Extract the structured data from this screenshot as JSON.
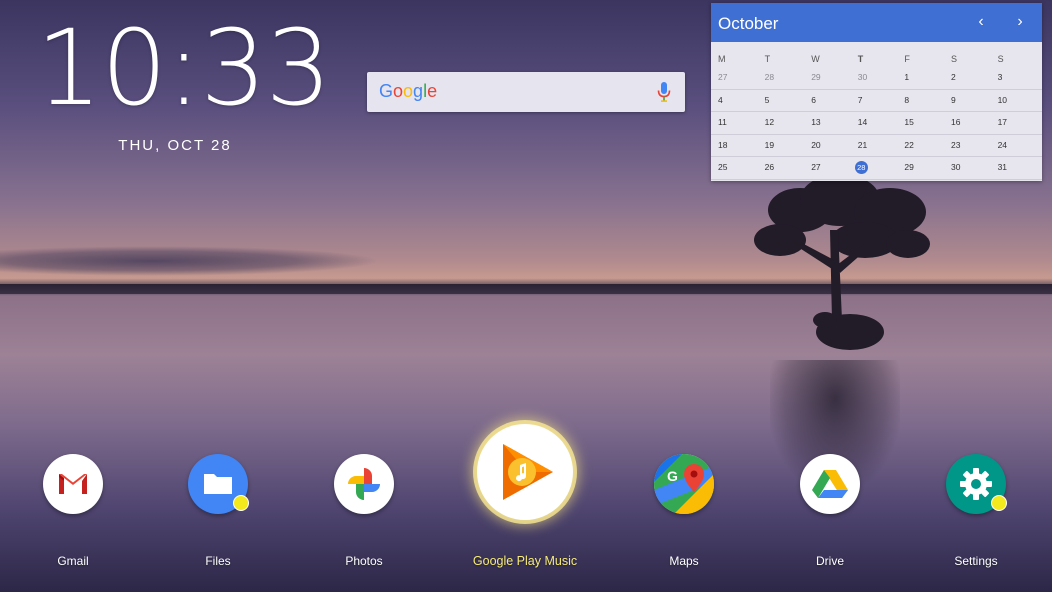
{
  "clock": {
    "time": "10:33",
    "date": "THU, OCT 28"
  },
  "search": {
    "logo_text": "Google",
    "icon": "mic-icon"
  },
  "calendar": {
    "month": "October",
    "weekdays": [
      "M",
      "T",
      "W",
      "T",
      "F",
      "S",
      "S"
    ],
    "today_weekday_index": 3,
    "weeks": [
      [
        "27",
        "28",
        "29",
        "30",
        "1",
        "2",
        "3"
      ],
      [
        "4",
        "5",
        "6",
        "7",
        "8",
        "9",
        "10"
      ],
      [
        "11",
        "12",
        "13",
        "14",
        "15",
        "16",
        "17"
      ],
      [
        "18",
        "19",
        "20",
        "21",
        "22",
        "23",
        "24"
      ],
      [
        "25",
        "26",
        "27",
        "28",
        "29",
        "30",
        "31"
      ]
    ],
    "today": "28",
    "accent": "#3f6fd3"
  },
  "apps": [
    {
      "label": "Gmail",
      "icon": "gmail-icon"
    },
    {
      "label": "Files",
      "icon": "files-icon",
      "badge": true
    },
    {
      "label": "Photos",
      "icon": "photos-icon"
    },
    {
      "label": "Google Play Music",
      "icon": "play-music-icon",
      "focused": true
    },
    {
      "label": "Maps",
      "icon": "maps-icon"
    },
    {
      "label": "Drive",
      "icon": "drive-icon"
    },
    {
      "label": "Settings",
      "icon": "settings-icon",
      "badge": true
    }
  ],
  "colors": {
    "badge": "#f3ea1e",
    "focus_label": "#f6eb7a"
  }
}
